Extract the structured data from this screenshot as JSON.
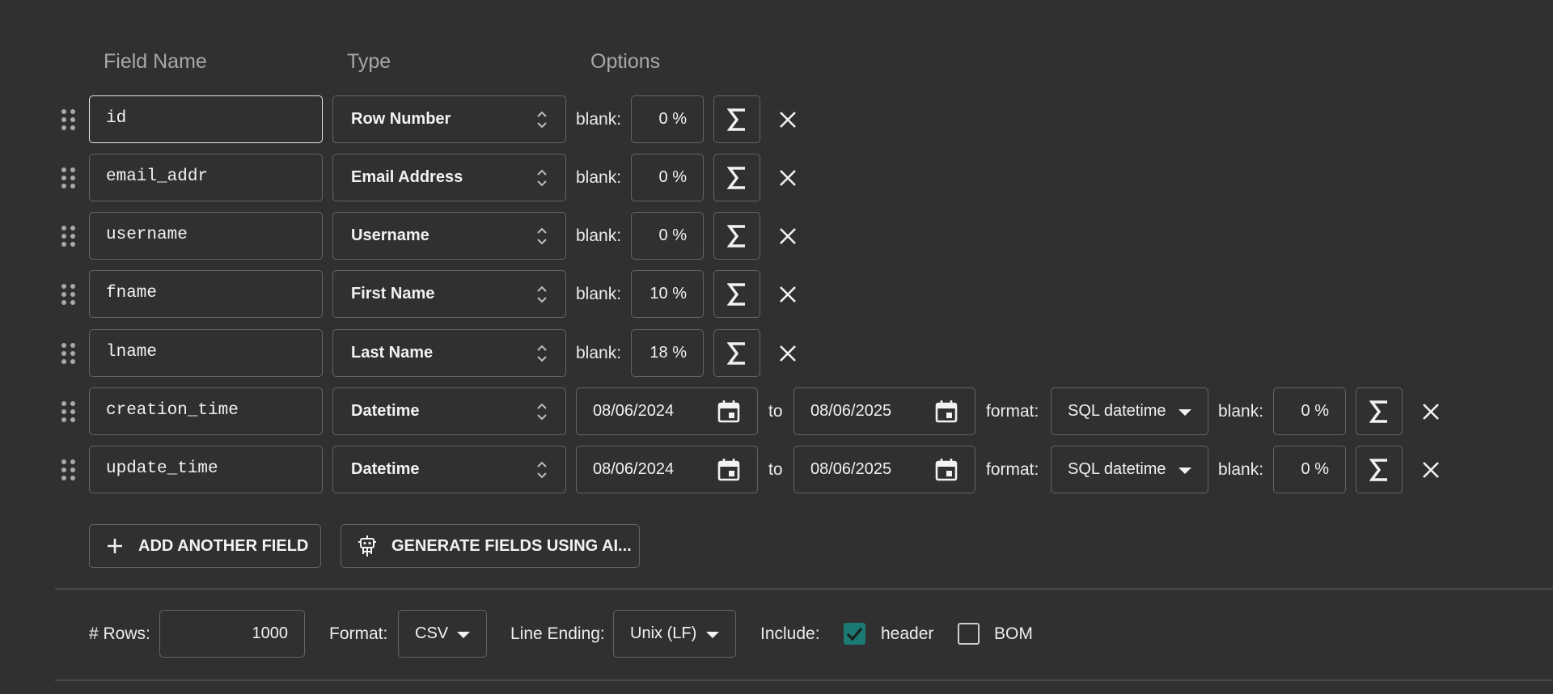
{
  "headers": {
    "field_name": "Field Name",
    "type": "Type",
    "options": "Options"
  },
  "labels": {
    "blank": "blank:",
    "to": "to",
    "format": "format:"
  },
  "fields": [
    {
      "name": "id",
      "type": "Row Number",
      "blank": "0 %"
    },
    {
      "name": "email_addr",
      "type": "Email Address",
      "blank": "0 %"
    },
    {
      "name": "username",
      "type": "Username",
      "blank": "0 %"
    },
    {
      "name": "fname",
      "type": "First Name",
      "blank": "10 %"
    },
    {
      "name": "lname",
      "type": "Last Name",
      "blank": "18 %"
    },
    {
      "name": "creation_time",
      "type": "Datetime",
      "from": "08/06/2024",
      "to": "08/06/2025",
      "format": "SQL datetime",
      "blank": "0 %"
    },
    {
      "name": "update_time",
      "type": "Datetime",
      "from": "08/06/2024",
      "to": "08/06/2025",
      "format": "SQL datetime",
      "blank": "0 %"
    }
  ],
  "buttons": {
    "add_field": "ADD ANOTHER FIELD",
    "generate_ai": "GENERATE FIELDS USING AI..."
  },
  "footer": {
    "rows_label": "# Rows:",
    "rows_value": "1000",
    "format_label": "Format:",
    "format_value": "CSV",
    "line_ending_label": "Line Ending:",
    "line_ending_value": "Unix (LF)",
    "include_label": "Include:",
    "header_label": "header",
    "header_checked": true,
    "bom_label": "BOM",
    "bom_checked": false
  },
  "icons": {
    "drag": "drag-handle-icon",
    "type_select": "chevron-up-down-icon",
    "formula": "sigma-icon",
    "remove": "close-icon",
    "date": "calendar-icon",
    "dropdown": "caret-down-icon",
    "add": "plus-icon",
    "ai": "robot-icon",
    "check": "check-icon"
  },
  "colors": {
    "background": "#303030",
    "border": "#646464",
    "checkbox_accent": "#1a7a73"
  }
}
